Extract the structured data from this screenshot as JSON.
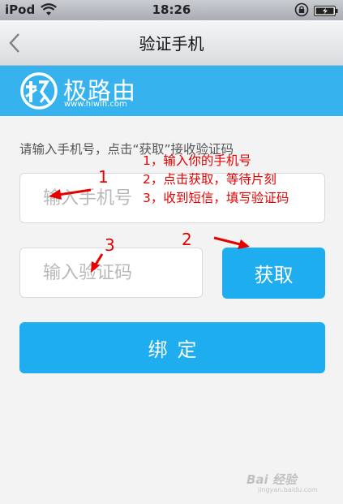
{
  "status_bar": {
    "carrier": "iPod",
    "time": "18:26"
  },
  "nav": {
    "title": "验证手机"
  },
  "brand": {
    "name": "极路由",
    "url": "www.hiwifi.com",
    "color": "#36b3ee"
  },
  "form": {
    "instruction": "请输入手机号，点击“获取”接收验证码",
    "phone_placeholder": "输入手机号",
    "phone_value": "",
    "code_placeholder": "输入验证码",
    "code_value": "",
    "get_code_label": "获取",
    "bind_label": "绑定",
    "accent_color": "#1eaeef"
  },
  "annotations": {
    "steps": [
      "1，输入你的手机号",
      "2，点击获取，等待片刻",
      "3，收到短信，填写验证码"
    ],
    "markers": [
      "1",
      "2",
      "3"
    ],
    "color": "#e60000"
  },
  "watermark": {
    "text": "Bai 经验",
    "sub": "jingyan.baidu.com"
  }
}
